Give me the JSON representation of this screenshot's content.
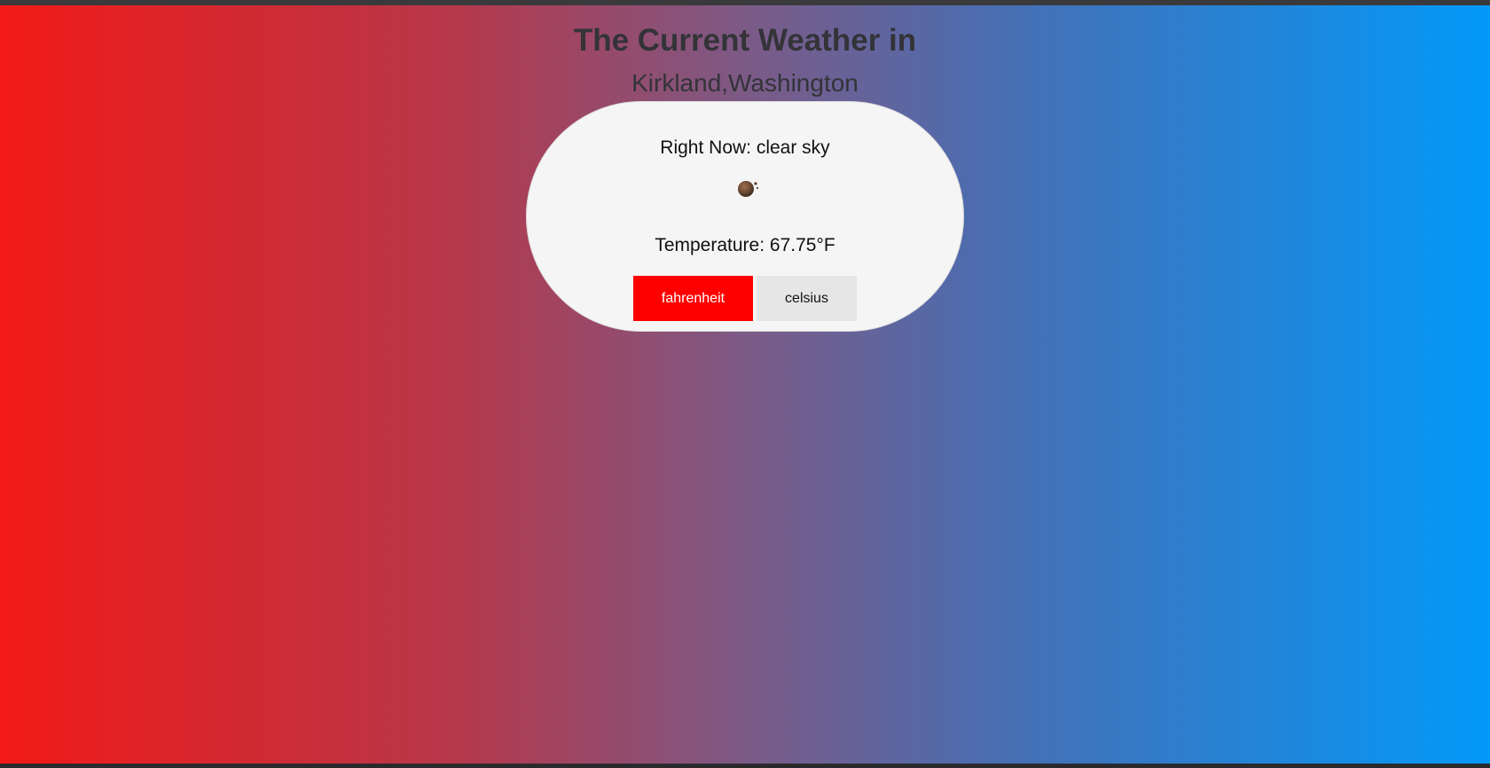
{
  "header": {
    "title": "The Current Weather in",
    "location": "Kirkland,Washington"
  },
  "weather": {
    "condition_text": "Right Now: clear sky",
    "icon": "clear-sky-night-icon",
    "temperature_text": "Temperature: 67.75°F"
  },
  "units": {
    "fahrenheit_label": "fahrenheit",
    "celsius_label": "celsius",
    "selected": "fahrenheit"
  },
  "colors": {
    "gradient_start": "#f21a17",
    "gradient_end": "#0299f9",
    "active_button": "#ff0000",
    "inactive_button": "#e6e6e6",
    "card_background": "#f5f5f5"
  }
}
